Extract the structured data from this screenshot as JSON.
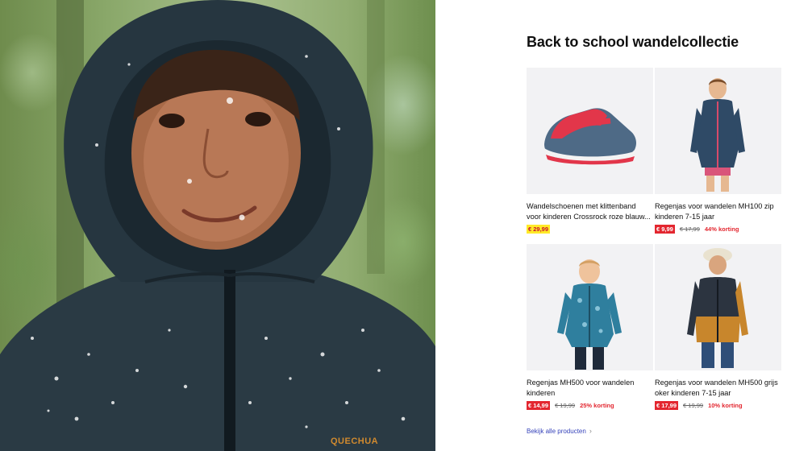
{
  "hero": {
    "brand_text": "QUECHUA"
  },
  "section": {
    "title": "Back to school wandelcollectie",
    "see_all_label": "Bekijk alle producten",
    "see_all_icon": "chevron-right-icon"
  },
  "products": [
    {
      "name_line1": "Wandelschoenen met klittenband",
      "name_line2": "voor kinderen Crossrock roze blauw...",
      "price": "€ 29,99",
      "price_style": "yellow",
      "old_price": "",
      "discount": ""
    },
    {
      "name_line1": "Regenjas voor wandelen MH100 zip",
      "name_line2": "kinderen 7-15 jaar",
      "price": "€ 9,99",
      "price_style": "red",
      "old_price": "€ 17,99",
      "discount": "44% korting"
    },
    {
      "name_line1": "Regenjas MH500 voor wandelen",
      "name_line2": "kinderen",
      "price": "€ 14,99",
      "price_style": "red",
      "old_price": "€ 19,99",
      "discount": "25% korting"
    },
    {
      "name_line1": "Regenjas voor wandelen MH500 grijs",
      "name_line2": "oker kinderen 7-15 jaar",
      "price": "€ 17,99",
      "price_style": "red",
      "old_price": "€ 19,99",
      "discount": "10% korting"
    }
  ],
  "colors": {
    "accent_link": "#3643ba",
    "price_red": "#e3262f",
    "price_yellow": "#ffea28"
  }
}
